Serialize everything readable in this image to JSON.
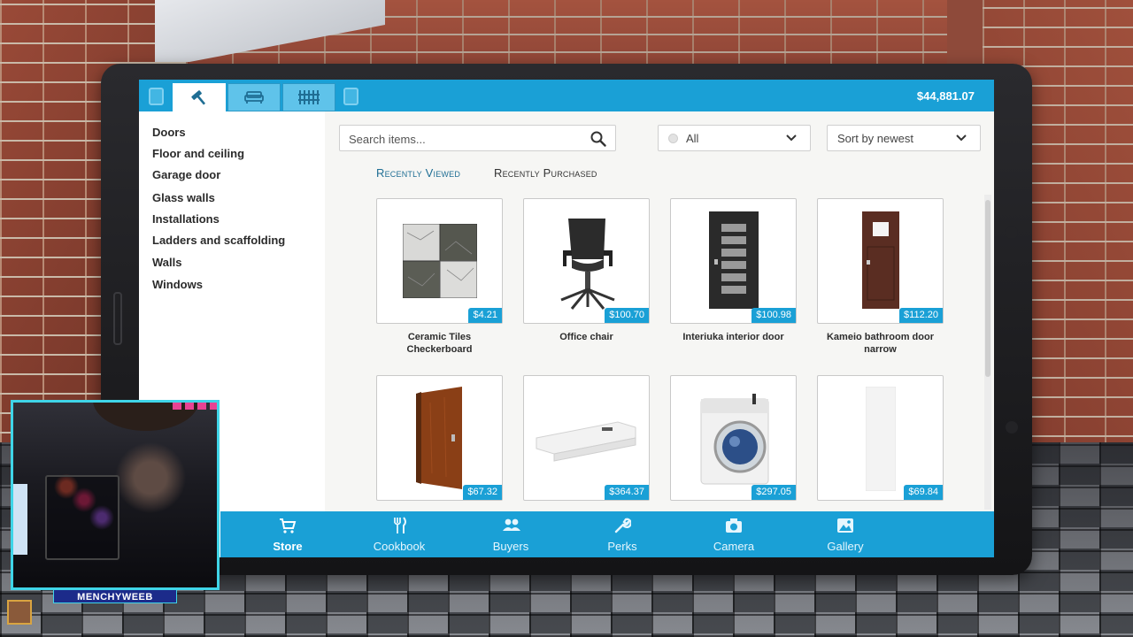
{
  "app": {
    "balance": "$44,881.07"
  },
  "tabs": {
    "categories": [
      {
        "icon": "hammer-icon",
        "active": true
      },
      {
        "icon": "sofa-icon",
        "active": false
      },
      {
        "icon": "fence-icon",
        "active": false
      }
    ]
  },
  "sidebar": {
    "items": [
      {
        "label": "Doors"
      },
      {
        "label": "Floor and ceiling"
      },
      {
        "label": "Garage door"
      },
      {
        "label": "Glass walls"
      },
      {
        "label": "Installations"
      },
      {
        "label": "Ladders and scaffolding"
      },
      {
        "label": "Walls"
      },
      {
        "label": "Windows"
      }
    ]
  },
  "search": {
    "placeholder": "Search items..."
  },
  "filter": {
    "selected": "All"
  },
  "sort": {
    "selected": "Sort by newest"
  },
  "subtabs": [
    {
      "label": "Recently Viewed",
      "active": true
    },
    {
      "label": "Recently Purchased",
      "active": false
    }
  ],
  "items": [
    {
      "name": "Ceramic Tiles Checkerboard",
      "price": "$4.21"
    },
    {
      "name": "Office chair",
      "price": "$100.70"
    },
    {
      "name": "Interiuka interior door",
      "price": "$100.98"
    },
    {
      "name": "Kameio bathroom door narrow",
      "price": "$112.20"
    },
    {
      "name": "",
      "price": "$67.32"
    },
    {
      "name": "",
      "price": "$364.37"
    },
    {
      "name": "",
      "price": "$297.05"
    },
    {
      "name": "",
      "price": "$69.84"
    }
  ],
  "bottom_nav": [
    {
      "label": "Store",
      "icon": "cart-icon",
      "active": true
    },
    {
      "label": "Cookbook",
      "icon": "cutlery-icon",
      "active": false
    },
    {
      "label": "Buyers",
      "icon": "people-icon",
      "active": false
    },
    {
      "label": "Perks",
      "icon": "wrench-icon",
      "active": false
    },
    {
      "label": "Camera",
      "icon": "camera-icon",
      "active": false
    },
    {
      "label": "Gallery",
      "icon": "image-icon",
      "active": false
    }
  ],
  "overlay": {
    "streamer_name": "MENCHYWEEB"
  },
  "colors": {
    "accent": "#1aa0d6",
    "webcam_border": "#3fd5e8"
  }
}
